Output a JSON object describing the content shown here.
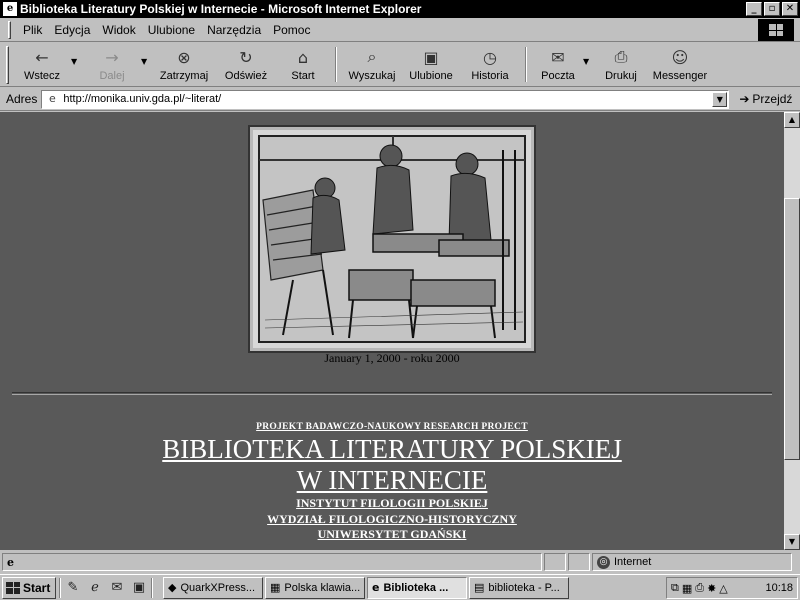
{
  "window": {
    "app_icon": "e",
    "title": "Biblioteka Literatury Polskiej w Internecie - Microsoft Internet Explorer",
    "minimize": "_",
    "maximize": "▫",
    "close": "✕"
  },
  "menu": {
    "items": [
      {
        "label": "Plik"
      },
      {
        "label": "Edycja"
      },
      {
        "label": "Widok"
      },
      {
        "label": "Ulubione"
      },
      {
        "label": "Narzędzia"
      },
      {
        "label": "Pomoc"
      }
    ]
  },
  "toolbar": {
    "back": {
      "label": "Wstecz",
      "icon": "←"
    },
    "forward": {
      "label": "Dalej",
      "icon": "→"
    },
    "stop": {
      "label": "Zatrzymaj",
      "icon": "⊗"
    },
    "refresh": {
      "label": "Odśwież",
      "icon": "↻"
    },
    "home": {
      "label": "Start",
      "icon": "⌂"
    },
    "search": {
      "label": "Wyszukaj",
      "icon": "⌕"
    },
    "favorites": {
      "label": "Ulubione",
      "icon": "▣"
    },
    "history": {
      "label": "Historia",
      "icon": "◷"
    },
    "mail": {
      "label": "Poczta",
      "icon": "✉"
    },
    "print": {
      "label": "Drukuj",
      "icon": "⎙"
    },
    "messenger": {
      "label": "Messenger",
      "icon": "☺"
    }
  },
  "address": {
    "label": "Adres",
    "url": "http://monika.univ.gda.pl/~literat/",
    "go_label": "Przejdź",
    "go_icon": "➔"
  },
  "page": {
    "caption": "January 1, 2000 - roku 2000",
    "project": "PROJEKT BADAWCZO-NAUKOWY RESEARCH PROJECT",
    "title_line1": "BIBLIOTEKA LITERATURY POLSKIEJ",
    "title_line2": "W INTERNECIE",
    "institute": "INSTYTUT FILOLOGII POLSKIEJ",
    "faculty": "WYDZIAŁ FILOLOGICZNO-HISTORYCZNY",
    "university": "UNIWERSYTET GDAŃSKI"
  },
  "status": {
    "page_icon": "e",
    "text": "",
    "zone_icon": "◎",
    "zone": "Internet"
  },
  "taskbar": {
    "start": "Start",
    "tasks": [
      {
        "label": "QuarkXPress...",
        "icon": "◆"
      },
      {
        "label": "Polska klawia...",
        "icon": "▦"
      },
      {
        "label": "Biblioteka ...",
        "icon": "e"
      },
      {
        "label": "biblioteka - P...",
        "icon": "▤"
      }
    ],
    "clock": "10:18"
  }
}
